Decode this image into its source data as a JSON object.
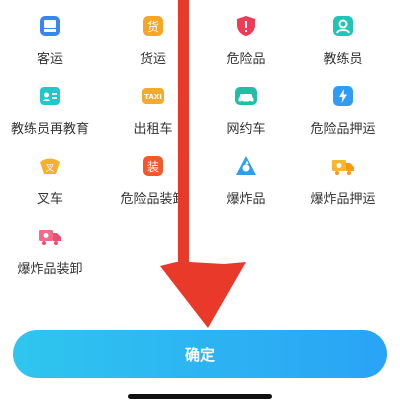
{
  "categories": [
    {
      "label": "客运",
      "icon": "bus-icon"
    },
    {
      "label": "货运",
      "icon": "cargo-icon"
    },
    {
      "label": "危险品",
      "icon": "hazard-shield-icon"
    },
    {
      "label": "教练员",
      "icon": "instructor-icon"
    },
    {
      "label": "教练员再教育",
      "icon": "id-card-icon"
    },
    {
      "label": "出租车",
      "icon": "taxi-icon"
    },
    {
      "label": "网约车",
      "icon": "car-icon"
    },
    {
      "label": "危险品押运",
      "icon": "escort-icon"
    },
    {
      "label": "叉车",
      "icon": "forklift-icon"
    },
    {
      "label": "危险品装卸",
      "icon": "loading-icon"
    },
    {
      "label": "爆炸品",
      "icon": "explosive-icon"
    },
    {
      "label": "爆炸品押运",
      "icon": "explosive-truck-icon"
    },
    {
      "label": "爆炸品装卸",
      "icon": "explosive-loading-icon"
    }
  ],
  "confirm_button": {
    "label": "确定"
  },
  "icon_text": {
    "cargo": "货",
    "taxi": "TAXI",
    "forklift": "叉",
    "loading": "装"
  },
  "colors": {
    "accent": "#2aa3f6",
    "arrow": "#e8392a"
  }
}
